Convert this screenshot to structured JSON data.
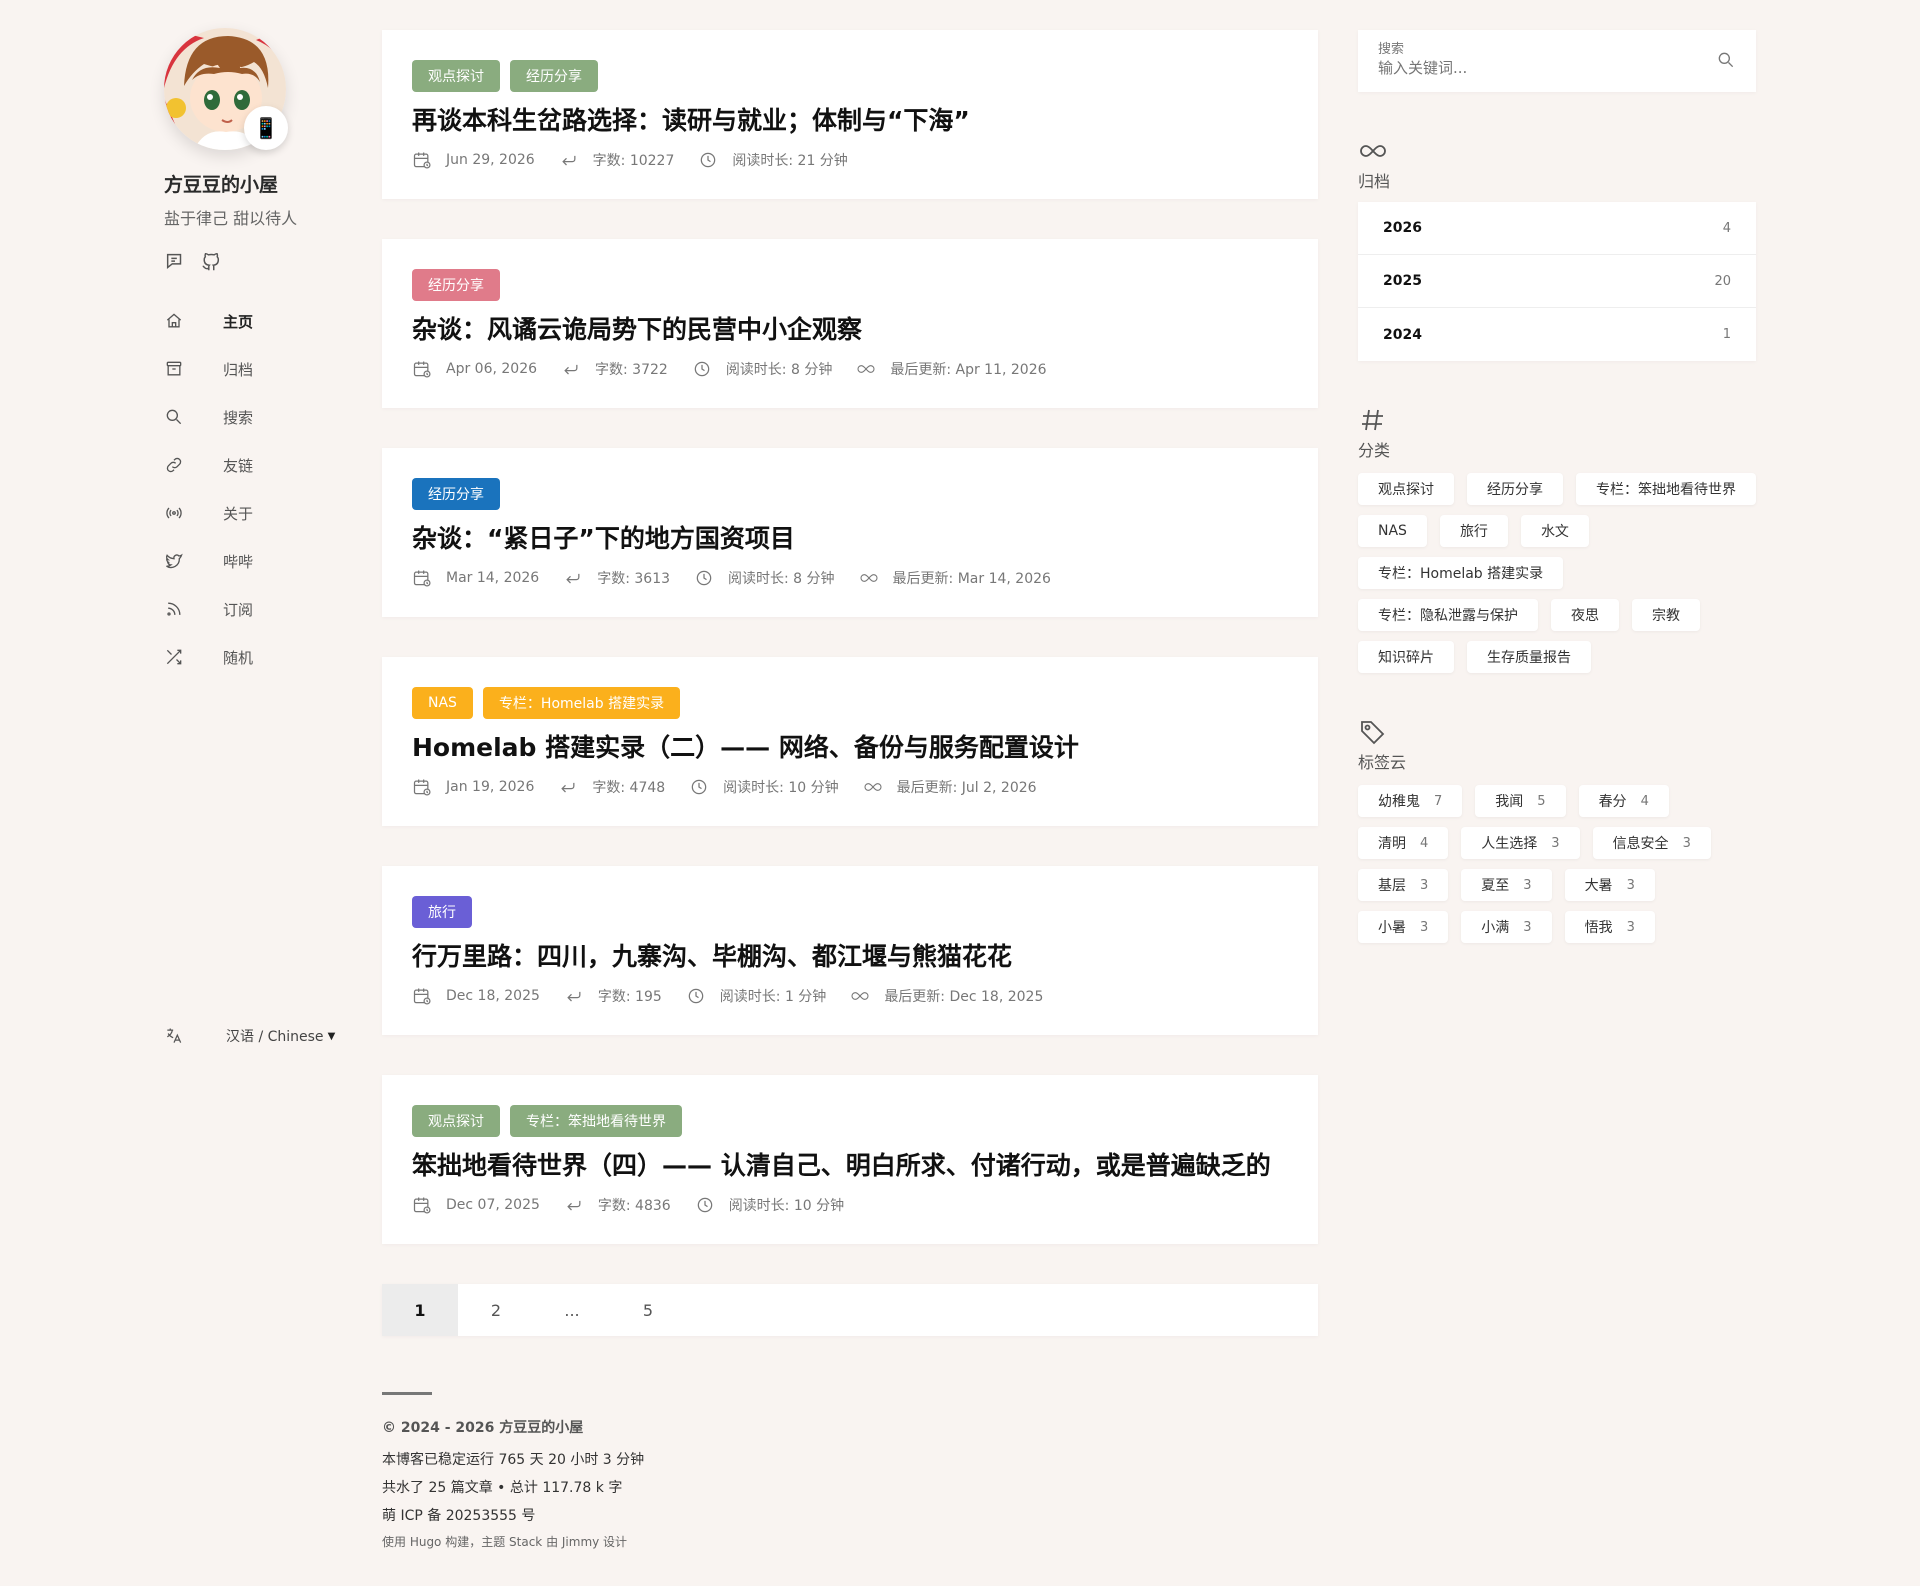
{
  "site": {
    "name": "方豆豆的小屋",
    "description": "盐于律己 甜以待人",
    "avatar_emoji": "📱"
  },
  "menu": [
    {
      "label": "主页",
      "icon": "home-icon",
      "active": true
    },
    {
      "label": "归档",
      "icon": "archive-icon"
    },
    {
      "label": "搜索",
      "icon": "search-icon"
    },
    {
      "label": "友链",
      "icon": "link-icon"
    },
    {
      "label": "关于",
      "icon": "broadcast-icon"
    },
    {
      "label": "哔哔",
      "icon": "twitter-icon"
    },
    {
      "label": "订阅",
      "icon": "rss-icon"
    },
    {
      "label": "随机",
      "icon": "shuffle-icon"
    }
  ],
  "language": {
    "value": "汉语 / Chinese"
  },
  "posts": [
    {
      "tags": [
        {
          "label": "观点探讨",
          "color": "#8aac7f"
        },
        {
          "label": "经历分享",
          "color": "#8aac7f"
        }
      ],
      "title": "再谈本科生岔路选择：读研与就业；体制与“下海”",
      "date": "Jun 29, 2026",
      "words": "字数: 10227",
      "read": "阅读时长: 21 分钟",
      "updated": ""
    },
    {
      "tags": [
        {
          "label": "经历分享",
          "color": "#e07b8a"
        }
      ],
      "title": "杂谈：风谲云诡局势下的民营中小企观察",
      "date": "Apr 06, 2026",
      "words": "字数: 3722",
      "read": "阅读时长: 8 分钟",
      "updated": "最后更新: Apr 11, 2026"
    },
    {
      "tags": [
        {
          "label": "经历分享",
          "color": "#1a73bd"
        }
      ],
      "title": "杂谈：“紧日子”下的地方国资项目",
      "date": "Mar 14, 2026",
      "words": "字数: 3613",
      "read": "阅读时长: 8 分钟",
      "updated": "最后更新: Mar 14, 2026"
    },
    {
      "tags": [
        {
          "label": "NAS",
          "color": "#fbb01c"
        },
        {
          "label": "专栏：Homelab 搭建实录",
          "color": "#fbb01c"
        }
      ],
      "title": "Homelab 搭建实录（二）—— 网络、备份与服务配置设计",
      "date": "Jan 19, 2026",
      "words": "字数: 4748",
      "read": "阅读时长: 10 分钟",
      "updated": "最后更新: Jul 2, 2026"
    },
    {
      "tags": [
        {
          "label": "旅行",
          "color": "#6a5fd6"
        }
      ],
      "title": "行万里路：四川，九寨沟、毕棚沟、都江堰与熊猫花花",
      "date": "Dec 18, 2025",
      "words": "字数: 195",
      "read": "阅读时长: 1 分钟",
      "updated": "最后更新: Dec 18, 2025"
    },
    {
      "tags": [
        {
          "label": "观点探讨",
          "color": "#8aac7f"
        },
        {
          "label": "专栏：笨拙地看待世界",
          "color": "#8aac7f"
        }
      ],
      "title": "笨拙地看待世界（四）—— 认清自己、明白所求、付诸行动，或是普遍缺乏的",
      "date": "Dec 07, 2025",
      "words": "字数: 4836",
      "read": "阅读时长: 10 分钟",
      "updated": ""
    }
  ],
  "pagination": [
    {
      "label": "1",
      "current": true
    },
    {
      "label": "2"
    },
    {
      "label": "..."
    },
    {
      "label": "5"
    }
  ],
  "footer": {
    "copyright": "© 2024 - 2026 方豆豆的小屋",
    "uptime": "本博客已稳定运行 765 天 20 小时 3 分钟",
    "stats": "共水了 25 篇文章 • 总计 117.78 k 字",
    "icp": "萌 ICP 备 20253555 号",
    "built": "使用 Hugo 构建，主题 Stack 由 Jimmy 设计"
  },
  "search": {
    "label": "搜索",
    "placeholder": "输入关键词..."
  },
  "archive": {
    "title": "归档",
    "years": [
      {
        "year": "2026",
        "count": "4"
      },
      {
        "year": "2025",
        "count": "20"
      },
      {
        "year": "2024",
        "count": "1"
      }
    ]
  },
  "categories": {
    "title": "分类",
    "items": [
      "观点探讨",
      "经历分享",
      "专栏：笨拙地看待世界",
      "NAS",
      "旅行",
      "水文",
      "专栏：Homelab 搭建实录",
      "专栏：隐私泄露与保护",
      "夜思",
      "宗教",
      "知识碎片",
      "生存质量报告"
    ]
  },
  "tagcloud": {
    "title": "标签云",
    "items": [
      {
        "label": "幼稚鬼",
        "count": "7"
      },
      {
        "label": "我闻",
        "count": "5"
      },
      {
        "label": "春分",
        "count": "4"
      },
      {
        "label": "清明",
        "count": "4"
      },
      {
        "label": "人生选择",
        "count": "3"
      },
      {
        "label": "信息安全",
        "count": "3"
      },
      {
        "label": "基层",
        "count": "3"
      },
      {
        "label": "夏至",
        "count": "3"
      },
      {
        "label": "大暑",
        "count": "3"
      },
      {
        "label": "小暑",
        "count": "3"
      },
      {
        "label": "小满",
        "count": "3"
      },
      {
        "label": "悟我",
        "count": "3"
      }
    ]
  }
}
